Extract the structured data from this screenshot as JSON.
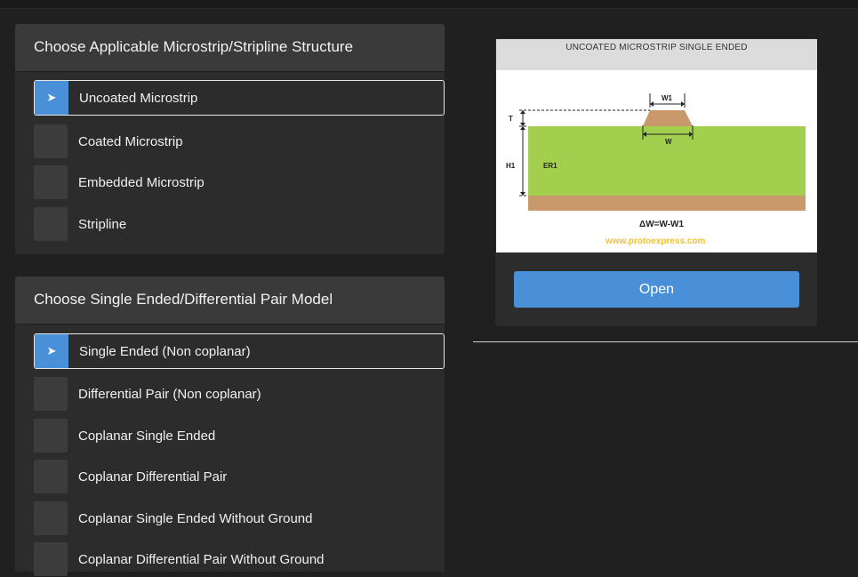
{
  "structure_panel": {
    "title": "Choose Applicable Microstrip/Stripline Structure",
    "options": [
      {
        "label": "Uncoated Microstrip",
        "selected": true
      },
      {
        "label": "Coated Microstrip",
        "selected": false
      },
      {
        "label": "Embedded Microstrip",
        "selected": false
      },
      {
        "label": "Stripline",
        "selected": false
      }
    ]
  },
  "model_panel": {
    "title": "Choose Single Ended/Differential Pair Model",
    "options": [
      {
        "label": "Single Ended (Non coplanar)",
        "selected": true
      },
      {
        "label": "Differential Pair (Non coplanar)",
        "selected": false
      },
      {
        "label": "Coplanar Single Ended",
        "selected": false
      },
      {
        "label": "Coplanar Differential Pair",
        "selected": false
      },
      {
        "label": "Coplanar Single Ended Without Ground",
        "selected": false
      },
      {
        "label": "Coplanar Differential Pair Without Ground",
        "selected": false
      }
    ]
  },
  "preview": {
    "diagram_title": "UNCOATED MICROSTRIP SINGLE ENDED",
    "labels": {
      "w1": "W1",
      "w": "W",
      "t": "T",
      "h1": "H1",
      "er1": "ER1",
      "formula": "ΔW=W-W1",
      "website": "www.protoexpress.com"
    },
    "open_label": "Open"
  },
  "colors": {
    "accent": "#4a90d8",
    "dielectric": "#a3cf4e",
    "copper": "#c9996b",
    "website": "#f2c12e"
  },
  "icons": {
    "selected_marker": "➤"
  }
}
